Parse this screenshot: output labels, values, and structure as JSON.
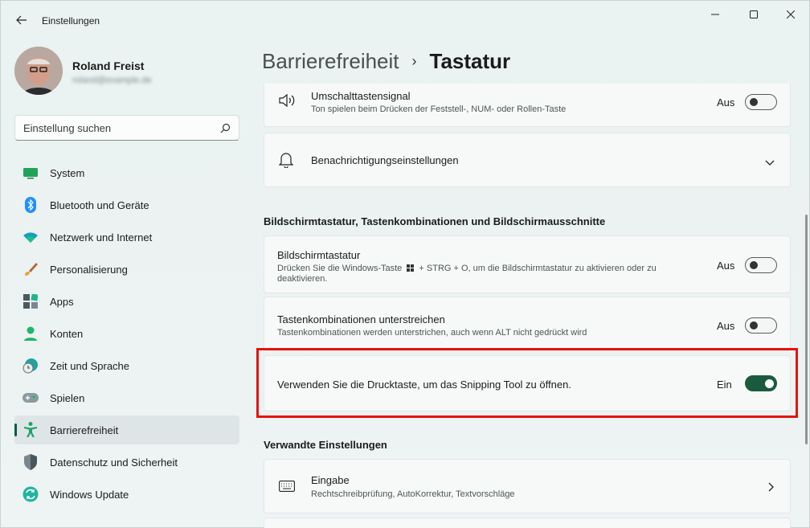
{
  "window": {
    "title": "Einstellungen"
  },
  "profile": {
    "name": "Roland Freist",
    "email": "roland@example.de"
  },
  "search": {
    "placeholder": "Einstellung suchen"
  },
  "sidebar": {
    "items": [
      {
        "label": "System",
        "icon": "system-icon"
      },
      {
        "label": "Bluetooth und Geräte",
        "icon": "bluetooth-icon"
      },
      {
        "label": "Netzwerk und Internet",
        "icon": "wifi-icon"
      },
      {
        "label": "Personalisierung",
        "icon": "brush-icon"
      },
      {
        "label": "Apps",
        "icon": "apps-icon"
      },
      {
        "label": "Konten",
        "icon": "account-icon"
      },
      {
        "label": "Zeit und Sprache",
        "icon": "clock-icon"
      },
      {
        "label": "Spielen",
        "icon": "gamepad-icon"
      },
      {
        "label": "Barrierefreiheit",
        "icon": "accessibility-icon"
      },
      {
        "label": "Datenschutz und Sicherheit",
        "icon": "shield-icon"
      },
      {
        "label": "Windows Update",
        "icon": "update-icon"
      }
    ],
    "active_index": 8
  },
  "breadcrumb": {
    "parent": "Barrierefreiheit",
    "separator": "›",
    "current": "Tastatur"
  },
  "cards": {
    "toggle_keys_sound": {
      "title": "Umschalttastensignal",
      "subtitle": "Ton spielen beim Drücken der Feststell-, NUM- oder Rollen-Taste",
      "state": "Aus"
    },
    "notifications": {
      "title": "Benachrichtigungseinstellungen"
    },
    "onscreen_keyboard": {
      "title": "Bildschirmtastatur",
      "subtitle_pre": "Drücken Sie die Windows-Taste",
      "subtitle_post": "+ STRG + O, um die Bildschirmtastatur zu aktivieren oder zu",
      "subtitle_line2": "deaktivieren.",
      "state": "Aus"
    },
    "underline_shortcuts": {
      "title": "Tastenkombinationen unterstreichen",
      "subtitle": "Tastenkombinationen werden unterstrichen, auch wenn ALT nicht gedrückt wird",
      "state": "Aus"
    },
    "print_screen": {
      "title": "Verwenden Sie die Drucktaste, um das Snipping Tool zu öffnen.",
      "state": "Ein"
    },
    "input": {
      "title": "Eingabe",
      "subtitle": "Rechtschreibprüfung, AutoKorrektur, Textvorschläge"
    }
  },
  "sections": {
    "keyboard_shortcuts": "Bildschirmtastatur, Tastenkombinationen und Bildschirmausschnitte",
    "related": "Verwandte Einstellungen"
  },
  "colors": {
    "accent": "#1a5a3e",
    "highlight": "#e4140c"
  }
}
